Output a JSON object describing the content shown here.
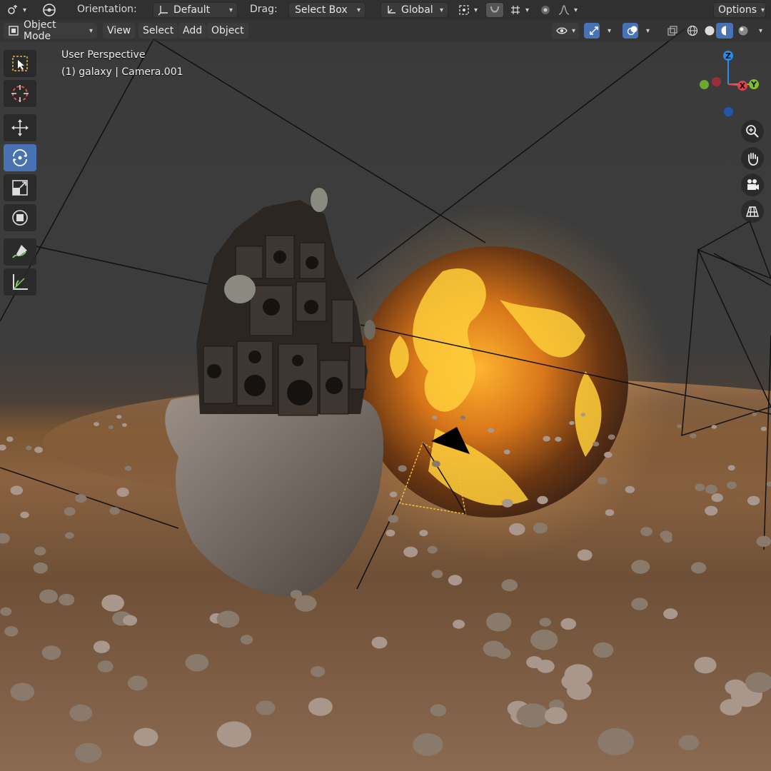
{
  "header": {
    "orientation_label": "Orientation:",
    "orientation_value": "Default",
    "drag_label": "Drag:",
    "drag_value": "Select Box",
    "transform_value": "Global",
    "options_label": "Options"
  },
  "menu": {
    "mode_value": "Object Mode",
    "items": [
      {
        "label": "View"
      },
      {
        "label": "Select"
      },
      {
        "label": "Add"
      },
      {
        "label": "Object"
      }
    ]
  },
  "viewport": {
    "perspective_label": "User Perspective",
    "object_label": "(1) galaxy | Camera.001"
  },
  "gizmo": {
    "z_label": "Z",
    "y_label": "Y",
    "x_label": "X"
  },
  "colors": {
    "accent": "#4772b3",
    "axis_x": "#e0414d",
    "axis_y": "#7fbf2a",
    "axis_z": "#2a8cf0"
  },
  "icons": {
    "tools": [
      "select-box-icon",
      "cursor-icon",
      "move-icon",
      "rotate-icon",
      "scale-icon",
      "transform-icon",
      "annotate-icon",
      "measure-icon"
    ],
    "nav": [
      "zoom-icon",
      "hand-pan-icon",
      "camera-view-icon",
      "grid-ortho-icon"
    ]
  }
}
